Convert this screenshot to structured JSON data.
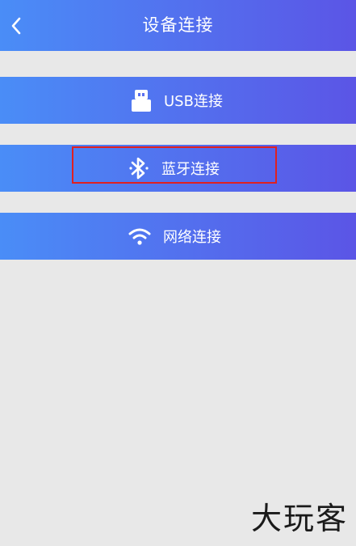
{
  "header": {
    "title": "设备连接",
    "back_icon": "chevron-left-icon",
    "gradient": [
      "#4a8df7",
      "#5b55e6"
    ]
  },
  "connections": [
    {
      "label": "USB连接",
      "icon": "usb-icon"
    },
    {
      "label": "蓝牙连接",
      "icon": "bluetooth-icon",
      "highlighted": true
    },
    {
      "label": "网络连接",
      "icon": "wifi-icon"
    }
  ],
  "highlight_color": "#e02020",
  "background_color": "#e8e8e8",
  "watermark": "大玩客"
}
